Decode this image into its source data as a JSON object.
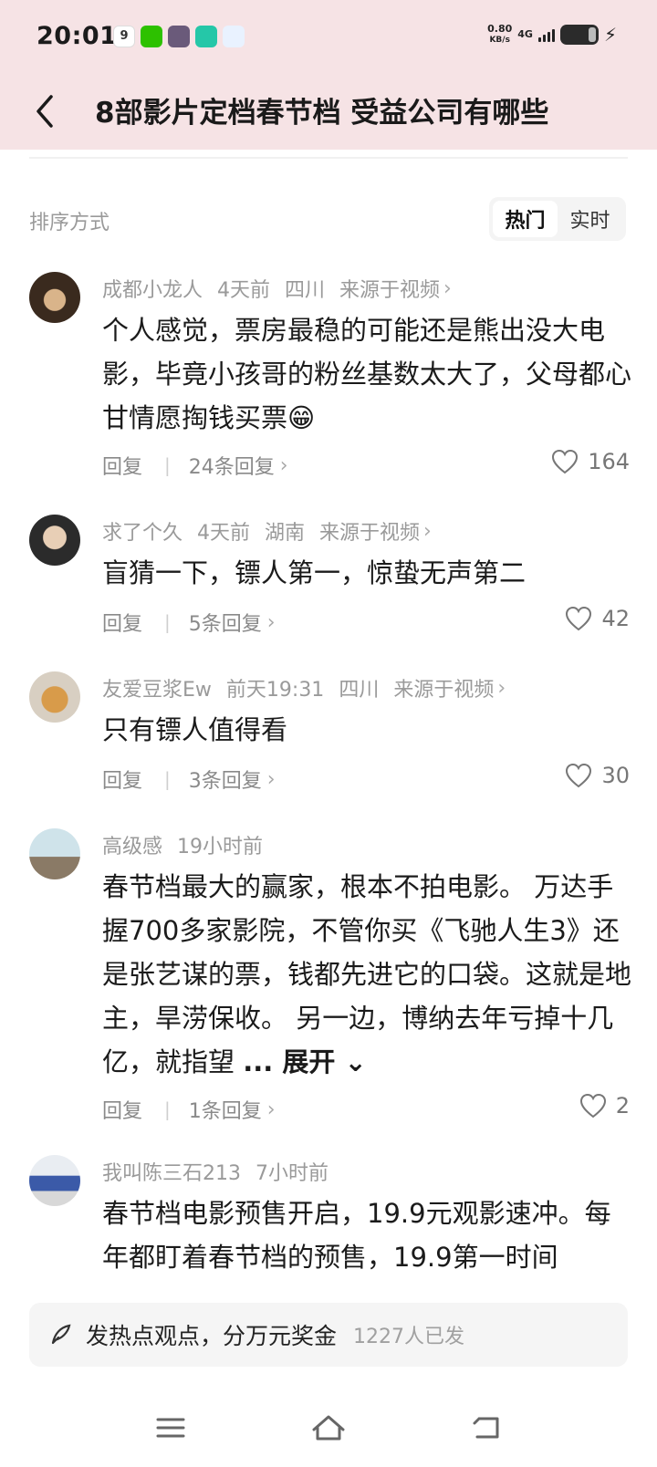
{
  "status_bar": {
    "time": "20:01",
    "net_speed_value": "0.80",
    "net_speed_unit": "KB/s",
    "network": "4G"
  },
  "header": {
    "title": "8部影片定档春节档 受益公司有哪些"
  },
  "sort": {
    "label": "排序方式",
    "options": [
      "热门",
      "实时"
    ],
    "selected": "热门"
  },
  "comments": [
    {
      "user": "成都小龙人",
      "time": "4天前",
      "location": "四川",
      "source": "来源于视频",
      "text": "个人感觉，票房最稳的可能还是熊出没大电影，毕竟小孩哥的粉丝基数太大了，父母都心甘情愿掏钱买票😁",
      "reply_label": "回复",
      "replies": "24条回复",
      "likes": "164"
    },
    {
      "user": "求了个久",
      "time": "4天前",
      "location": "湖南",
      "source": "来源于视频",
      "text": "盲猜一下，镖人第一，惊蛰无声第二",
      "reply_label": "回复",
      "replies": "5条回复",
      "likes": "42"
    },
    {
      "user": "友爱豆浆Ew",
      "time": "前天19:31",
      "location": "四川",
      "source": "来源于视频",
      "text": "只有镖人值得看",
      "reply_label": "回复",
      "replies": "3条回复",
      "likes": "30"
    },
    {
      "user": "高级感",
      "time": "19小时前",
      "text": "春节档最大的赢家，根本不拍电影。 万达手握700多家影院，不管你买《飞驰人生3》还是张艺谋的票，钱都先进它的口袋。这就是地主，旱涝保收。 另一边，博纳去年亏掉十几亿，就指望 ",
      "expand_label": "... 展开",
      "reply_label": "回复",
      "replies": "1条回复",
      "likes": "2"
    },
    {
      "user": "我叫陈三石213",
      "time": "7小时前",
      "text": "春节档电影预售开启，19.9元观影速冲。每年都盯着春节档的预售，19.9第一时间"
    }
  ],
  "bottom_bar": {
    "prompt": "发热点观点，分万元奖金",
    "count": "1227人已发"
  },
  "icons": {
    "back": "chevron-left-icon",
    "like": "heart-icon",
    "pen": "pen-icon",
    "nav_menu": "menu-icon",
    "nav_home": "home-icon",
    "nav_back": "return-icon"
  },
  "colors": {
    "header_bg": "#f6e3e5",
    "meta_gray": "#9a9a9a"
  }
}
